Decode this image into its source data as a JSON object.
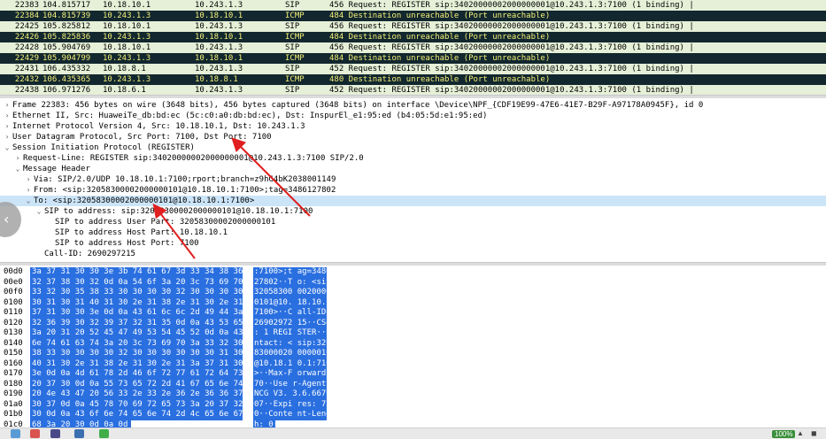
{
  "packets": [
    {
      "no": "22383",
      "time": "104.815717",
      "src": "10.18.10.1",
      "dst": "10.243.1.3",
      "proto": "SIP",
      "info": "456 Request: REGISTER sip:34020000002000000001@10.243.1.3:7100  (1 binding) |",
      "type": "sip"
    },
    {
      "no": "22384",
      "time": "104.815739",
      "src": "10.243.1.3",
      "dst": "10.18.10.1",
      "proto": "ICMP",
      "info": "484 Destination unreachable (Port unreachable)",
      "type": "icmp"
    },
    {
      "no": "22425",
      "time": "105.825812",
      "src": "10.18.10.1",
      "dst": "10.243.1.3",
      "proto": "SIP",
      "info": "456 Request: REGISTER sip:34020000002000000001@10.243.1.3:7100  (1 binding) |",
      "type": "sip"
    },
    {
      "no": "22426",
      "time": "105.825836",
      "src": "10.243.1.3",
      "dst": "10.18.10.1",
      "proto": "ICMP",
      "info": "484 Destination unreachable (Port unreachable)",
      "type": "icmp"
    },
    {
      "no": "22428",
      "time": "105.904769",
      "src": "10.18.10.1",
      "dst": "10.243.1.3",
      "proto": "SIP",
      "info": "456 Request: REGISTER sip:34020000002000000001@10.243.1.3:7100  (1 binding) |",
      "type": "sip"
    },
    {
      "no": "22429",
      "time": "105.904799",
      "src": "10.243.1.3",
      "dst": "10.18.10.1",
      "proto": "ICMP",
      "info": "484 Destination unreachable (Port unreachable)",
      "type": "icmp"
    },
    {
      "no": "22431",
      "time": "106.435332",
      "src": "10.18.8.1",
      "dst": "10.243.1.3",
      "proto": "SIP",
      "info": "452 Request: REGISTER sip:34020000002000000001@10.243.1.3:7100  (1 binding) |",
      "type": "sip"
    },
    {
      "no": "22432",
      "time": "106.435365",
      "src": "10.243.1.3",
      "dst": "10.18.8.1",
      "proto": "ICMP",
      "info": "480 Destination unreachable (Port unreachable)",
      "type": "icmp"
    },
    {
      "no": "22438",
      "time": "106.971276",
      "src": "10.18.6.1",
      "dst": "10.243.1.3",
      "proto": "SIP",
      "info": "452 Request: REGISTER sip:34020000002000000001@10.243.1.3:7100  (1 binding) |",
      "type": "sip"
    }
  ],
  "details": [
    {
      "arrow": ">",
      "indent": 0,
      "text": "Frame 22383: 456 bytes on wire (3648 bits), 456 bytes captured (3648 bits) on interface \\Device\\NPF_{CDF19E99-47E6-41E7-B29F-A97178A0945F}, id 0"
    },
    {
      "arrow": ">",
      "indent": 0,
      "text": "Ethernet II, Src: HuaweiTe_db:bd:ec (5c:c0:a0:db:bd:ec), Dst: InspurEl_e1:95:ed (b4:05:5d:e1:95:ed)"
    },
    {
      "arrow": ">",
      "indent": 0,
      "text": "Internet Protocol Version 4, Src: 10.18.10.1, Dst: 10.243.1.3"
    },
    {
      "arrow": ">",
      "indent": 0,
      "text": "User Datagram Protocol, Src Port: 7100, Dst Port: 7100"
    },
    {
      "arrow": "v",
      "indent": 0,
      "text": "Session Initiation Protocol (REGISTER)"
    },
    {
      "arrow": ">",
      "indent": 1,
      "text": "Request-Line: REGISTER sip:34020000002000000001@10.243.1.3:7100 SIP/2.0"
    },
    {
      "arrow": "v",
      "indent": 1,
      "text": "Message Header"
    },
    {
      "arrow": ">",
      "indent": 2,
      "text": "Via: SIP/2.0/UDP 10.18.10.1:7100;rport;branch=z9hG4bK2038001149"
    },
    {
      "arrow": ">",
      "indent": 2,
      "text": "From: <sip:32058300002000000101@10.18.10.1:7100>;tag=3486127802"
    },
    {
      "arrow": "v",
      "indent": 2,
      "text": "To: <sip:32058300002000000101@10.18.10.1:7100>",
      "selected": true
    },
    {
      "arrow": "v",
      "indent": 3,
      "text": "SIP to address: sip:32058300002000000101@10.18.10.1:7100"
    },
    {
      "arrow": "",
      "indent": 4,
      "text": "SIP to address User Part: 32058300002000000101"
    },
    {
      "arrow": "",
      "indent": 4,
      "text": "SIP to address Host Part: 10.18.10.1"
    },
    {
      "arrow": "",
      "indent": 4,
      "text": "SIP to address Host Port: 7100"
    },
    {
      "arrow": "",
      "indent": 3,
      "text": "Call-ID: 2690297215"
    }
  ],
  "hex": [
    {
      "off": "00d0",
      "bytes": "3a 37 31 30 30 3e 3b 74  61 67 3d 33 34 38 36 31",
      "ascii": ":7100>;t ag=34861"
    },
    {
      "off": "00e0",
      "bytes": "32 37 38 30 32 0d 0a 54  6f 3a 20 3c 73 69 70 3a",
      "ascii": "27802··T o: <sip:"
    },
    {
      "off": "00f0",
      "bytes": "33 32 30 35 38 33 30 30  30 30 32 30 30 30 30 30",
      "ascii": "32058300 00200000"
    },
    {
      "off": "0100",
      "bytes": "30 31 30 31 40 31 30 2e  31 38 2e 31 30 2e 31 3a",
      "ascii": "0101@10. 18.10.1:"
    },
    {
      "off": "0110",
      "bytes": "37 31 30 30 3e 0d 0a 43  61 6c 6c 2d 49 44 3a 20",
      "ascii": "7100>··C all-ID: "
    },
    {
      "off": "0120",
      "bytes": "32 36 39 30 32 39 37 32  31 35 0d 0a 43 53 65 71",
      "ascii": "26902972 15··CSeq"
    },
    {
      "off": "0130",
      "bytes": "3a 20 31 20 52 45 47 49  53 54 45 52 0d 0a 43 6f",
      "ascii": ": 1 REGI STER··Co"
    },
    {
      "off": "0140",
      "bytes": "6e 74 61 63 74 3a 20 3c  73 69 70 3a 33 32 30 35",
      "ascii": "ntact: < sip:3205"
    },
    {
      "off": "0150",
      "bytes": "38 33 30 30 30 30 32 30  30 30 30 30 30 31 30 31",
      "ascii": "83000020 00000101"
    },
    {
      "off": "0160",
      "bytes": "40 31 30 2e 31 38 2e 31  30 2e 31 3a 37 31 30 30",
      "ascii": "@10.18.1 0.1:7100"
    },
    {
      "off": "0170",
      "bytes": "3e 0d 0a 4d 61 78 2d 46  6f 72 77 61 72 64 73 3a",
      "ascii": ">··Max-F orwards:"
    },
    {
      "off": "0180",
      "bytes": "20 37 30 0d 0a 55 73 65  72 2d 41 67 65 6e 74 3a",
      "ascii": " 70··Use r-Agent:"
    },
    {
      "off": "0190",
      "bytes": "20 4e 43 47 20 56 33 2e  33 2e 36 2e 36 36 37 39",
      "ascii": " NCG V3. 3.6.6679"
    },
    {
      "off": "01a0",
      "bytes": "30 37 0d 0a 45 78 70 69  72 65 73 3a 20 37 32 30",
      "ascii": "07··Expi res: 720"
    },
    {
      "off": "01b0",
      "bytes": "30 0d 0a 43 6f 6e 74 65  6e 74 2d 4c 65 6e 67 74",
      "ascii": "0··Conte nt-Lengt"
    },
    {
      "off": "01c0",
      "bytes": "68 3a 20 30 0d 0a 0d 0a",
      "ascii": "h: 0····"
    }
  ],
  "taskbar": {
    "zoom": "100%"
  },
  "colors": {
    "sip_row": "#e6f0d8",
    "icmp_row": "#12272e",
    "icmp_text": "#f5f07a",
    "selection": "#cce4f7",
    "hex_highlight": "#2a6fe0",
    "annotation": "#e02020"
  }
}
